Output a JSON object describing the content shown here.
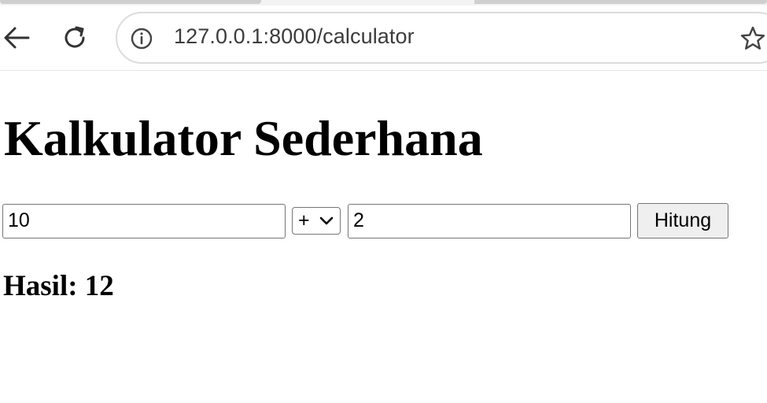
{
  "browser": {
    "url": "127.0.0.1:8000/calculator",
    "icons": [
      "back-arrow-icon",
      "reload-icon",
      "site-info-icon",
      "bookmark-star-icon"
    ]
  },
  "page": {
    "title": "Kalkulator Sederhana",
    "form": {
      "first_number": "10",
      "operator": "+",
      "second_number": "2",
      "submit_label": "Hitung"
    },
    "result_label": "Hasil: 12"
  }
}
